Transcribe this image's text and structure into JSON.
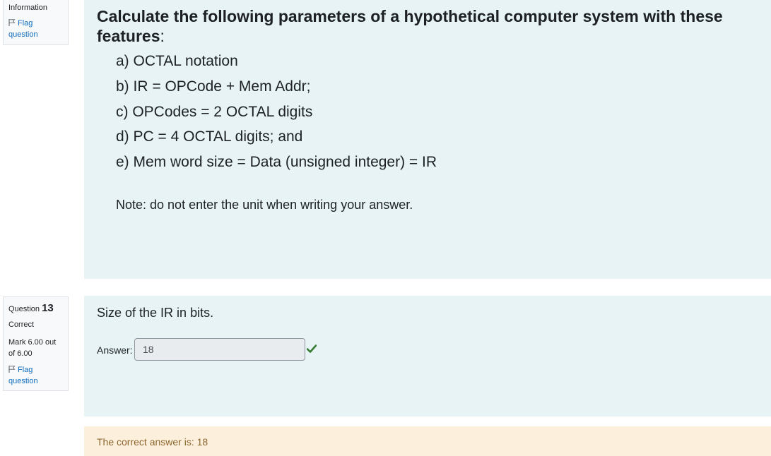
{
  "info_block": {
    "label": "Information",
    "flag_line1": "Flag",
    "flag_line2": "question"
  },
  "information_text": {
    "heading": "Calculate the following parameters of a hypothetical computer system with these features",
    "heading_colon": ":",
    "items": [
      "a) OCTAL notation",
      "b) IR = OPCode + Mem Addr;",
      "c) OPCodes = 2 OCTAL digits",
      "d) PC = 4 OCTAL digits; and",
      "e) Mem word size = Data (unsigned integer) = IR"
    ],
    "note": "Note: do not enter the unit when writing your answer."
  },
  "question13": {
    "label": "Question",
    "number": "13",
    "state": "Correct",
    "grade_line1": "Mark 6.00 out",
    "grade_line2": "of 6.00",
    "flag_line1": "Flag",
    "flag_line2": "question",
    "text": "Size of the IR in bits.",
    "answer_label": "Answer:",
    "answer_value": "18",
    "answer_status_icon": "check-icon",
    "correct_answer_text": "The correct answer is: 18"
  },
  "colors": {
    "link": "#0f6cbf",
    "panel_bg": "#e7f3f5",
    "feedback_bg": "#fcefdc",
    "feedback_text": "#8e662e",
    "check_green": "#357a32"
  }
}
